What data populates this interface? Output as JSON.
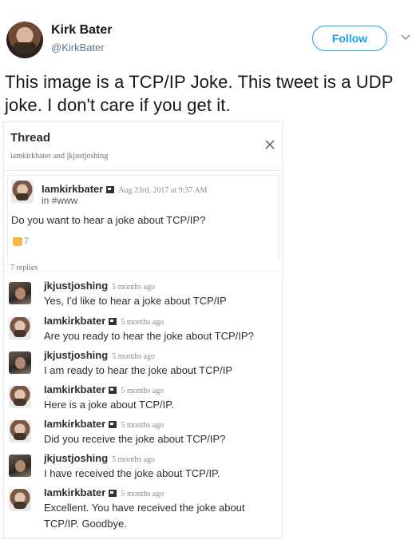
{
  "tweet": {
    "display_name": "Kirk Bater",
    "handle": "@KirkBater",
    "follow_label": "Follow",
    "text": "This image is a TCP/IP Joke.  This tweet is a UDP joke.  I don't care if you get it."
  },
  "thread": {
    "title": "Thread",
    "participants": "iamkirkbater and jkjustjoshing",
    "parent": {
      "user": "Iamkirkbater",
      "timestamp": "Aug 23rd, 2017 at 9:37 AM",
      "channel": "in #www",
      "text": "Do you want to hear a joke about TCP/IP?",
      "reaction_count": "7"
    },
    "replies_label": "7 replies",
    "replies": [
      {
        "user": "jkjustjoshing",
        "badge": false,
        "time": "5 months ago",
        "text": "Yes, I'd like to hear a joke about TCP/IP"
      },
      {
        "user": "Iamkirkbater",
        "badge": true,
        "time": "5 months ago",
        "text": "Are you ready to hear the joke about TCP/IP?"
      },
      {
        "user": "jkjustjoshing",
        "badge": false,
        "time": "5 months ago",
        "text": "I am ready to hear the joke about TCP/IP"
      },
      {
        "user": "Iamkirkbater",
        "badge": true,
        "time": "5 months ago",
        "text": "Here is a joke about TCP/IP."
      },
      {
        "user": "Iamkirkbater",
        "badge": true,
        "time": "5 months ago",
        "text": "Did you receive the joke about TCP/IP?"
      },
      {
        "user": "jkjustjoshing",
        "badge": false,
        "time": "5 months ago",
        "text": "I have received the joke about TCP/IP."
      },
      {
        "user": "Iamkirkbater",
        "badge": true,
        "time": "5 months ago",
        "text": "Excellent.  You have received the joke about TCP/IP.  Goodbye."
      }
    ]
  }
}
